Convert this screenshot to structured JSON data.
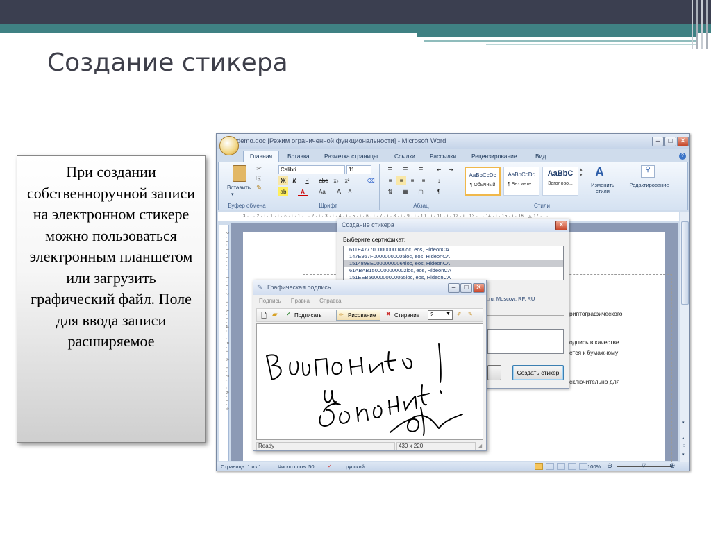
{
  "slide": {
    "title": "Создание стикера",
    "text": "При создании собственноручной записи на электронном стикере можно пользоваться электронным планшетом или загрузить графический файл. Поле для ввода записи расширяемое"
  },
  "word": {
    "title": "Stdemo.doc [Режим ограниченной функциональности] - Microsoft Word",
    "tabs": [
      "Главная",
      "Вставка",
      "Разметка страницы",
      "Ссылки",
      "Рассылки",
      "Рецензирование",
      "Вид"
    ],
    "clipboard": {
      "paste_label": "Вставить",
      "group_label": "Буфер обмена"
    },
    "font": {
      "name": "Calibri",
      "size": "11",
      "group_label": "Шрифт",
      "grow": "A",
      "shrink": "A",
      "aa": "Aa",
      "bold": "Ж",
      "italic": "К",
      "underline": "Ч",
      "strike": "abe",
      "sub": "x₂",
      "sup": "x²",
      "highlight": "ab",
      "color": "A"
    },
    "paragraph": {
      "group_label": "Абзац",
      "pilcrow": "¶"
    },
    "styles": {
      "group_label": "Стили",
      "items": [
        {
          "sample": "AaBbCcDc",
          "name": "¶ Обычный"
        },
        {
          "sample": "AaBbCcDc",
          "name": "¶ Без инте..."
        },
        {
          "sample": "AaBbC",
          "name": "Заголово..."
        }
      ],
      "change_label": "Изменить стили"
    },
    "editing_label": "Редактирование",
    "ruler": "3 · ı · 2 · ı · 1 · ı · ⌂ · ı · 1 · ı · 2 · ı · 3 · ı · 4 · ı · 5 · ı · 6 · ı · 7 · ı · 8 · ı · 9 · ı · 10 · ı · 11 · ı · 12 · ı · 13 · ı · 14 · ı · 15 · ı · 16 · △ 17 · ı ·",
    "vruler": "2 · ı · 1 · ı · · ı · 1 · ı · 2 · ı · 3 · ı · 4 · ı · 5 · ı · 6 · ı · 7 · ı · 8 · ı · 9",
    "doc_lines": [
      "риптографического",
      "одпись в качестве",
      "ется к бумажному",
      "сключительно для"
    ],
    "status": {
      "page": "Страница: 1 из 1",
      "words": "Число слов: 50",
      "lang": "русский",
      "zoom": "100%"
    }
  },
  "sticker_dialog": {
    "title": "Создание стикера",
    "select_label": "Выберите сертификат:",
    "certs": [
      "611E477700000000048loc, eos, HideonCA",
      "147E957F00000000005loc, eos, HideonCA",
      "151489BE00000000064loc, eos, HideonCA",
      "61ABAB1500000000002loc, eos, HideonCA",
      "151EEB5600000000065loc, eos, HideonCA"
    ],
    "selected_index": 2,
    "subject": ".ru, Moscow, RF, RU",
    "create_button": "Создать стикер"
  },
  "signature_window": {
    "title": "Графическая подпись",
    "menu": [
      "Подпись",
      "Правка",
      "Справка"
    ],
    "toolbar": {
      "sign": "Подписать",
      "draw": "Рисование",
      "erase": "Стирание",
      "width": "2"
    },
    "handwriting": [
      "Выполнить",
      "и",
      "доложить!"
    ],
    "status": {
      "state": "Ready",
      "size": "430 x 220"
    }
  }
}
